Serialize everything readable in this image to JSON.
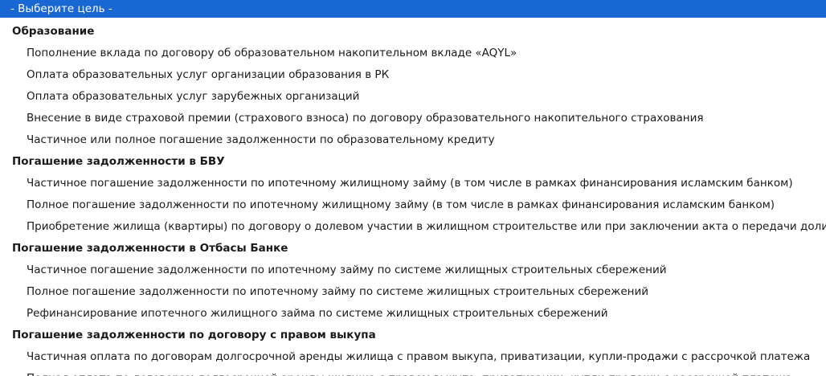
{
  "select": {
    "placeholder": "- Выберите цель -",
    "groups": [
      {
        "label": "Образование",
        "options": [
          "Пополнение вклада по договору об образовательном накопительном вкладе «AQYL»",
          "Оплата образовательных услуг организации образования в РК",
          "Оплата образовательных услуг зарубежных организаций",
          "Внесение в виде страховой премии (страхового взноса) по договору образовательного накопительного страхования",
          "Частичное или полное погашение задолженности по образовательному кредиту"
        ]
      },
      {
        "label": "Погашение задолженности в БВУ",
        "options": [
          "Частичное погашение задолженности по ипотечному жилищному займу (в том числе в рамках финансирования исламским банком)",
          "Полное погашение задолженности по ипотечному жилищному займу (в том числе в рамках финансирования исламским банком)",
          "Приобретение жилища (квартиры) по договору о долевом участии в жилищном строительстве или при заключении акта о передачи доли в мно"
        ]
      },
      {
        "label": "Погашение задолженности в Отбасы Банке",
        "options": [
          "Частичное погашение задолженности по ипотечному займу по системе жилищных строительных сбережений",
          "Полное погашение задолженности по ипотечному займу по системе жилищных строительных сбережений",
          "Рефинансирование ипотечного жилищного займа по системе жилищных строительных сбережений"
        ]
      },
      {
        "label": "Погашение задолженности по договору с правом выкупа",
        "options": [
          "Частичная оплата по договорам долгосрочной аренды жилища с правом выкупа, приватизации, купли-продажи с рассрочкой платежа",
          "Полная оплата по договорам долгосрочной аренды жилища с правом выкупа, приватизации, купли-продажи с рассрочкой платежа"
        ]
      }
    ],
    "colors": {
      "highlight": "#1967d2",
      "highlight_text": "#ffffff",
      "text": "#1a1a1a",
      "background": "#ffffff"
    }
  }
}
